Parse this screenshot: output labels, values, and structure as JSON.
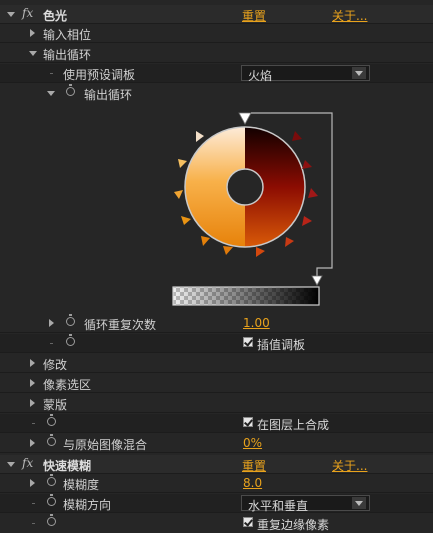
{
  "effect_colorama": {
    "fx_label": "fx",
    "name": "色光",
    "reset_label": "重置",
    "about_label": "关于..."
  },
  "input_phase": {
    "label": "输入相位"
  },
  "output_cycle": {
    "label": "输出循环",
    "use_preset_label": "使用预设调板",
    "preset_value": "火焰",
    "output_cycle_label": "输出循环"
  },
  "cycle_repetitions": {
    "label": "循环重复次数",
    "value": "1.00"
  },
  "interpolate_palette": {
    "label": "插值调板",
    "checked": true
  },
  "modify": {
    "label": "修改"
  },
  "pixel_selection": {
    "label": "像素选区"
  },
  "masking": {
    "label": "蒙版"
  },
  "composite_on_layer": {
    "label": "在图层上合成",
    "checked": true
  },
  "blend_with_original": {
    "label": "与原始图像混合",
    "value": "0%"
  },
  "effect_fast_blur": {
    "fx_label": "fx",
    "name": "快速模糊",
    "reset_label": "重置",
    "about_label": "关于..."
  },
  "blurriness": {
    "label": "模糊度",
    "value": "8.0"
  },
  "blur_dimensions": {
    "label": "模糊方向",
    "value": "水平和垂直"
  },
  "repeat_edge_pixels": {
    "label": "重复边缘像素",
    "checked": true
  },
  "colors": {
    "accent": "#e8a21c",
    "panel": "#262626"
  }
}
